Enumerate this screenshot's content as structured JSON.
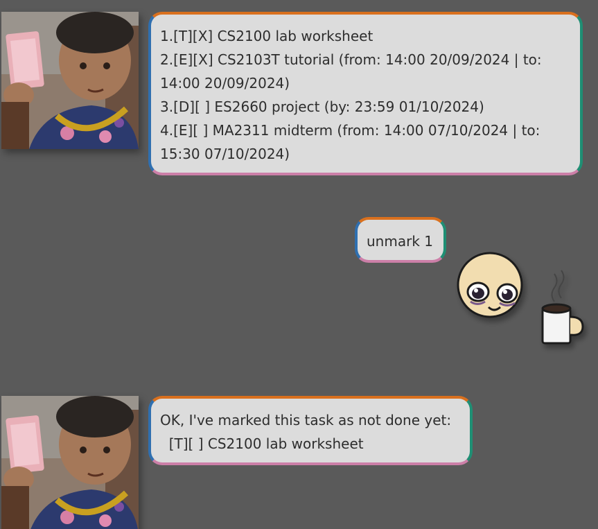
{
  "messages": [
    {
      "sender": "bot",
      "lines": [
        "1.[T][X] CS2100 lab worksheet",
        "2.[E][X] CS2103T tutorial (from: 14:00 20/09/2024 | to:",
        "14:00 20/09/2024)",
        "3.[D][ ] ES2660 project (by: 23:59 01/10/2024)",
        "4.[E][ ] MA2311 midterm (from: 14:00 07/10/2024 | to:",
        "15:30 07/10/2024)"
      ]
    },
    {
      "sender": "user",
      "lines": [
        "unmark 1"
      ]
    },
    {
      "sender": "bot",
      "lines": [
        "OK, I've marked this task as not done yet:",
        "  [T][ ] CS2100 lab worksheet"
      ]
    }
  ],
  "colors": {
    "background": "#5a5a5a",
    "bubble_fill": "#dcdcdc",
    "border_top": "#d9701e",
    "border_right": "#1f8f74",
    "border_bottom": "#cc7fa8",
    "border_left": "#2f6fb0"
  },
  "icons": {
    "bot_avatar": "woman-holding-cash-photo",
    "user_avatar": "sleepy-face-with-coffee-mug"
  }
}
